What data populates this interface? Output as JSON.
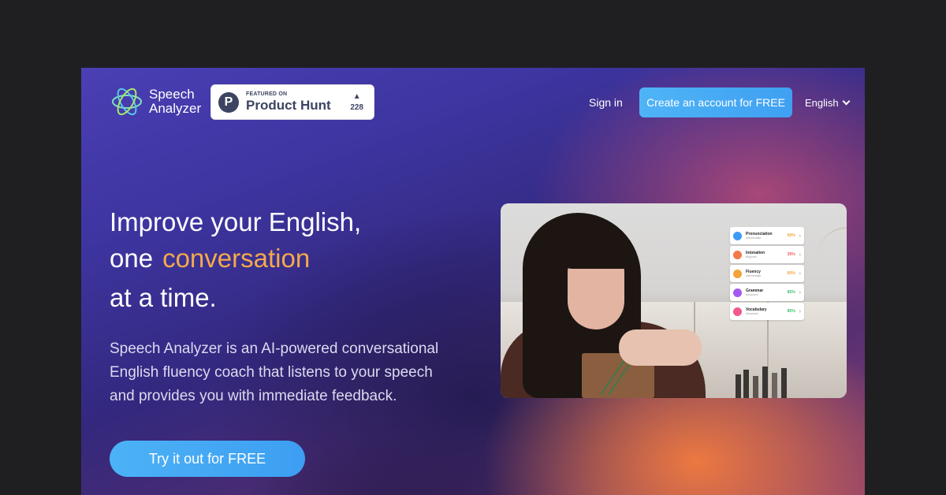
{
  "header": {
    "logo_text_line1": "Speech",
    "logo_text_line2": "Analyzer",
    "logo_icon": "atom-star-icon",
    "product_hunt": {
      "featured_label": "FEATURED ON",
      "name": "Product Hunt",
      "letter": "P",
      "upvote_icon": "triangle-up-icon",
      "votes": "228"
    },
    "sign_in": "Sign in",
    "create_account": "Create an account for FREE",
    "language": "English"
  },
  "hero": {
    "headline_line1": "Improve your English,",
    "headline_line2_prefix": "one",
    "headline_line2_accent": "conversation",
    "headline_line3": "at a time.",
    "description": "Speech Analyzer is an AI-powered conversational English fluency coach that listens to your speech and provides you with immediate feedback.",
    "cta": "Try it out for FREE"
  },
  "feedback_panel": {
    "items": [
      {
        "title": "Pronunciation",
        "subtitle": "Intermediate",
        "percent": "60%",
        "color": "#3e9bf2",
        "pct_color": "#f2a33a"
      },
      {
        "title": "Intonation",
        "subtitle": "Beginner",
        "percent": "30%",
        "color": "#f27a4a",
        "pct_color": "#f25a5a"
      },
      {
        "title": "Fluency",
        "subtitle": "Intermediate",
        "percent": "60%",
        "color": "#f2a33a",
        "pct_color": "#f2a33a"
      },
      {
        "title": "Grammar",
        "subtitle": "Advanced",
        "percent": "85%",
        "color": "#a45af2",
        "pct_color": "#3ac46a"
      },
      {
        "title": "Vocabulary",
        "subtitle": "Advanced",
        "percent": "85%",
        "color": "#f25a8a",
        "pct_color": "#3ac46a"
      }
    ]
  },
  "colors": {
    "accent_orange": "#f7a94a",
    "cta_blue": "#4cb2f6",
    "page_background": "#1f1f22"
  }
}
